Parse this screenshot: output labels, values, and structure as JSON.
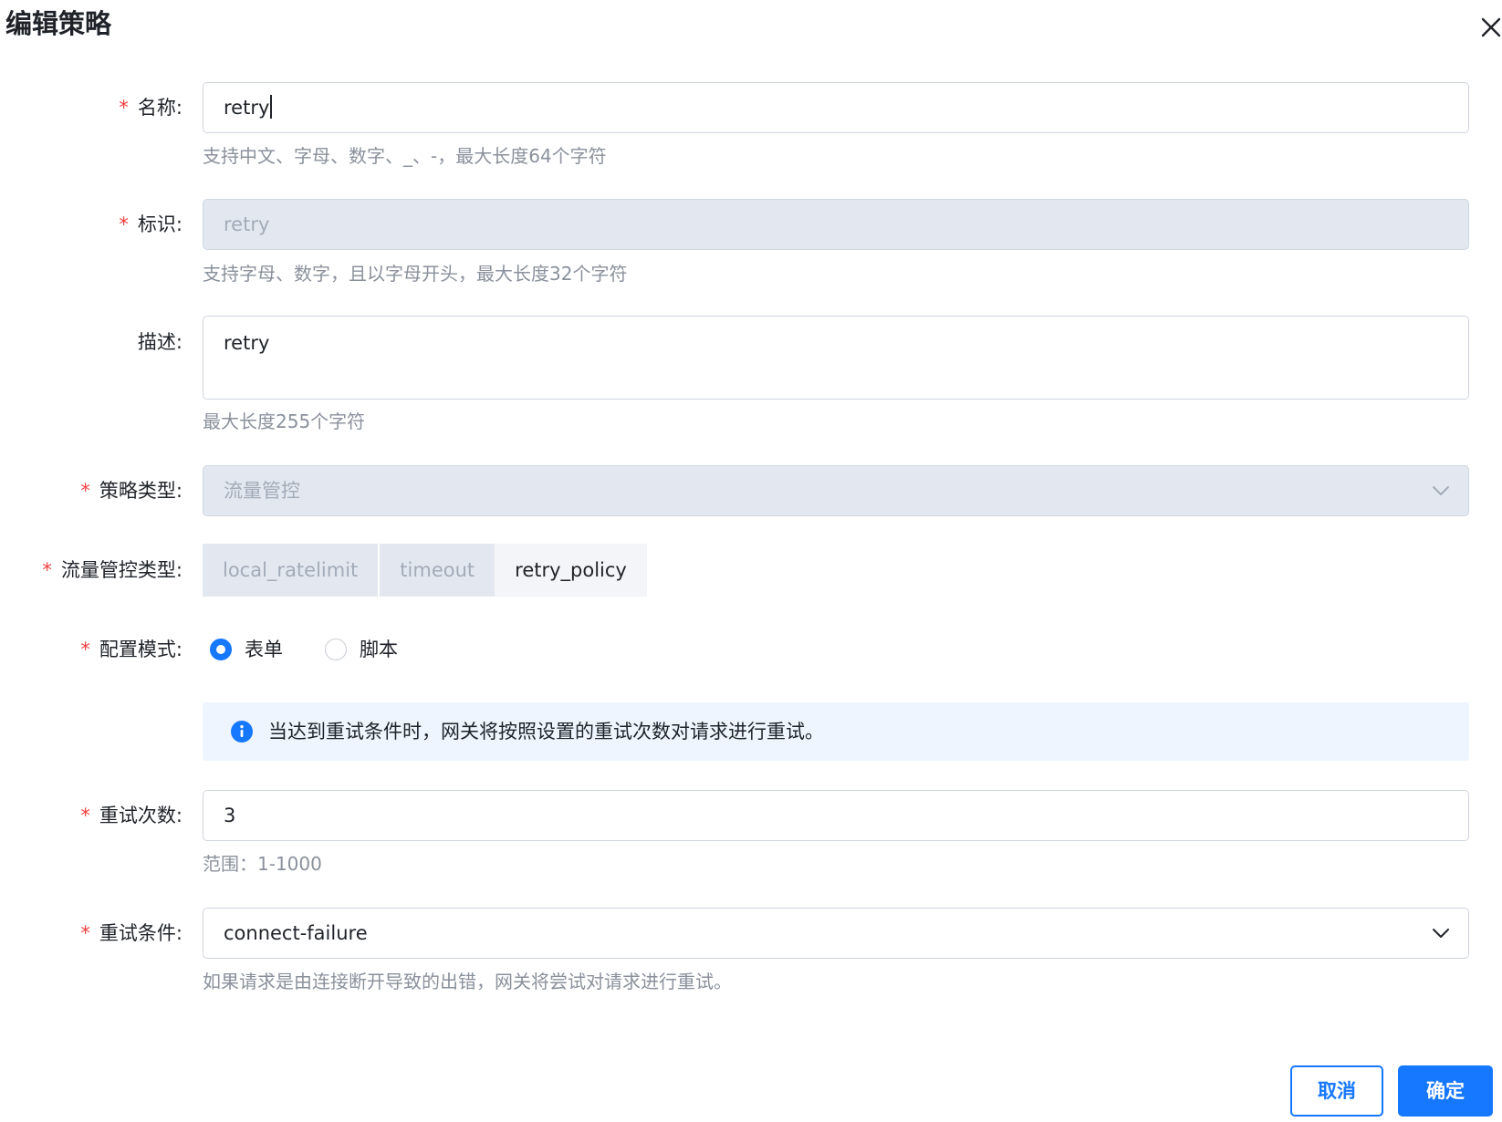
{
  "dialog": {
    "title": "编辑策略",
    "close_icon": "close-icon"
  },
  "form": {
    "name": {
      "label": "名称:",
      "required": "*",
      "value": "retry",
      "hint": "支持中文、字母、数字、_、-，最大长度64个字符"
    },
    "identifier": {
      "label": "标识:",
      "required": "*",
      "value": "retry",
      "hint": "支持字母、数字，且以字母开头，最大长度32个字符"
    },
    "description": {
      "label": "描述:",
      "value": "retry",
      "hint": "最大长度255个字符"
    },
    "policy_type": {
      "label": "策略类型:",
      "required": "*",
      "value": "流量管控",
      "icon": "chevron-down-icon"
    },
    "traffic_type": {
      "label": "流量管控类型:",
      "required": "*",
      "options": [
        "local_ratelimit",
        "timeout",
        "retry_policy"
      ],
      "selected": "retry_policy"
    },
    "config_mode": {
      "label": "配置模式:",
      "required": "*",
      "options": [
        "表单",
        "脚本"
      ],
      "selected": "表单"
    },
    "info": {
      "icon": "info-icon",
      "text": "当达到重试条件时，网关将按照设置的重试次数对请求进行重试。"
    },
    "retry_count": {
      "label": "重试次数:",
      "required": "*",
      "value": "3",
      "hint": "范围：1-1000"
    },
    "retry_condition": {
      "label": "重试条件:",
      "required": "*",
      "value": "connect-failure",
      "hint": "如果请求是由连接断开导致的出错，网关将尝试对请求进行重试。",
      "icon": "chevron-down-icon"
    }
  },
  "footer": {
    "cancel_label": "取消",
    "ok_label": "确定"
  },
  "colors": {
    "primary": "#1677ff",
    "required": "#f53f3f",
    "disabled_bg": "#e3e8f0",
    "hint": "#8a919c",
    "info_bg": "#eef5fe"
  }
}
